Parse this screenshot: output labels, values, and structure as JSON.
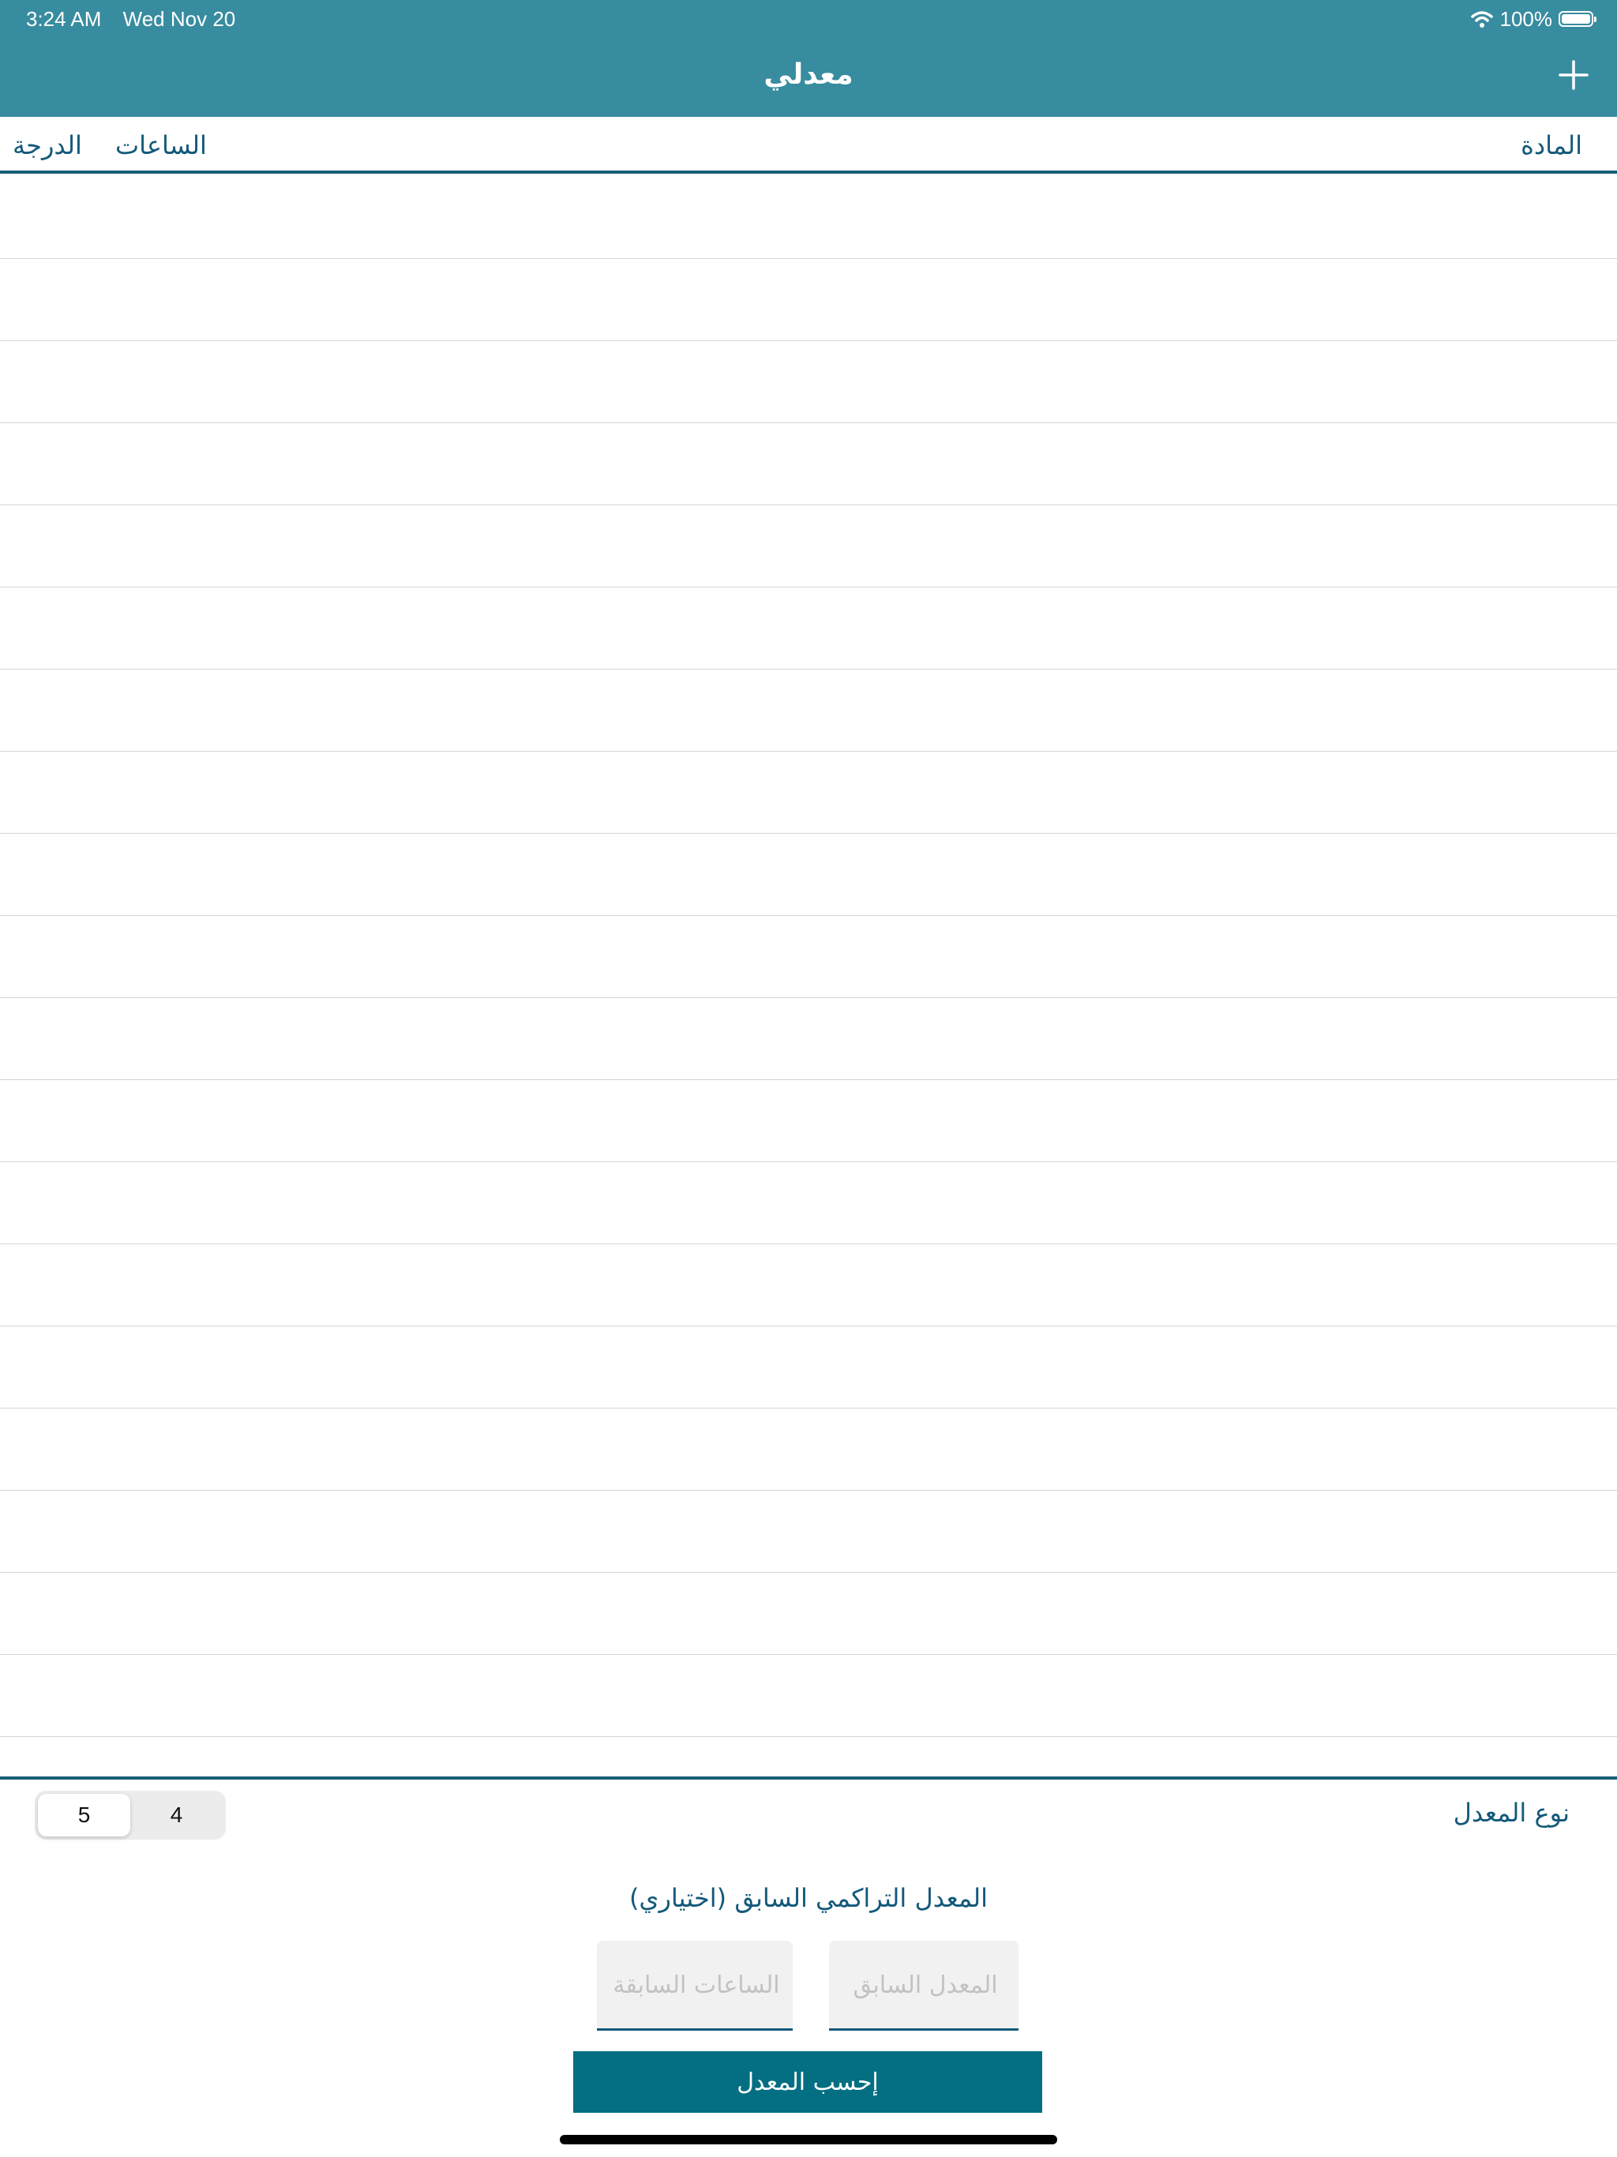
{
  "status_bar": {
    "time": "3:24 AM",
    "date": "Wed Nov 20",
    "battery": "100%",
    "battery_level": 1.0,
    "wifi_icon": "wifi-icon",
    "battery_icon": "battery-icon"
  },
  "nav": {
    "title": "معدلي",
    "add_icon": "plus-icon"
  },
  "columns": {
    "subject": "المادة",
    "hours": "الساعات",
    "grade": "الدرجة"
  },
  "gpa_type": {
    "label": "نوع المعدل",
    "options": [
      "5",
      "4"
    ],
    "selected": "5"
  },
  "previous": {
    "title": "المعدل التراكمي السابق (اختياري)",
    "gpa_placeholder": "المعدل السابق",
    "hours_placeholder": "الساعات السابقة"
  },
  "calculate_label": "إحسب المعدل",
  "colors": {
    "nav_bar": "#388c9f",
    "accent": "#13597a",
    "button": "#046e82"
  }
}
